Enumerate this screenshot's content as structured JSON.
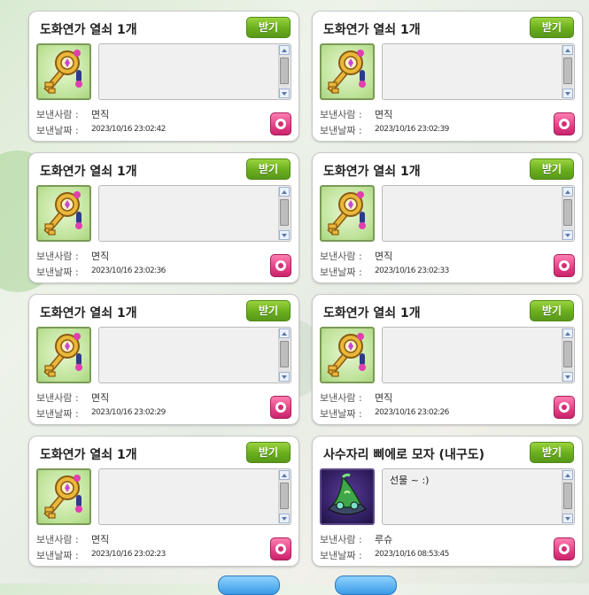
{
  "gifts": [
    {
      "title": "도화연가 열쇠 1개",
      "receive_label": "받기",
      "message": "",
      "sender_label": "보낸사람 :",
      "sender": "면직",
      "date_label": "보낸날짜 :",
      "date": "2023/10/16 23:02:42",
      "icon": "golden-key-icon"
    },
    {
      "title": "도화연가 열쇠 1개",
      "receive_label": "받기",
      "message": "",
      "sender_label": "보낸사람 :",
      "sender": "면직",
      "date_label": "보낸날짜 :",
      "date": "2023/10/16 23:02:39",
      "icon": "golden-key-icon"
    },
    {
      "title": "도화연가 열쇠 1개",
      "receive_label": "받기",
      "message": "",
      "sender_label": "보낸사람 :",
      "sender": "면직",
      "date_label": "보낸날짜 :",
      "date": "2023/10/16 23:02:36",
      "icon": "golden-key-icon"
    },
    {
      "title": "도화연가 열쇠 1개",
      "receive_label": "받기",
      "message": "",
      "sender_label": "보낸사람 :",
      "sender": "면직",
      "date_label": "보낸날짜 :",
      "date": "2023/10/16 23:02:33",
      "icon": "golden-key-icon"
    },
    {
      "title": "도화연가 열쇠 1개",
      "receive_label": "받기",
      "message": "",
      "sender_label": "보낸사람 :",
      "sender": "면직",
      "date_label": "보낸날짜 :",
      "date": "2023/10/16 23:02:29",
      "icon": "golden-key-icon"
    },
    {
      "title": "도화연가 열쇠 1개",
      "receive_label": "받기",
      "message": "",
      "sender_label": "보낸사람 :",
      "sender": "면직",
      "date_label": "보낸날짜 :",
      "date": "2023/10/16 23:02:26",
      "icon": "golden-key-icon"
    },
    {
      "title": "도화연가 열쇠 1개",
      "receive_label": "받기",
      "message": "",
      "sender_label": "보낸사람 :",
      "sender": "면직",
      "date_label": "보낸날짜 :",
      "date": "2023/10/16 23:02:23",
      "icon": "golden-key-icon"
    },
    {
      "title": "사수자리 삐에로 모자 (내구도)",
      "receive_label": "받기",
      "message": "선물 ~ :)",
      "sender_label": "보낸사람 :",
      "sender": "루슈",
      "date_label": "보낸날짜 :",
      "date": "2023/10/16 08:53:45",
      "icon": "sagittarius-clown-hat-icon"
    }
  ],
  "colors": {
    "receive_button": "#6aae1c",
    "delete_button": "#e33f86",
    "page_button": "#3a9be6"
  }
}
